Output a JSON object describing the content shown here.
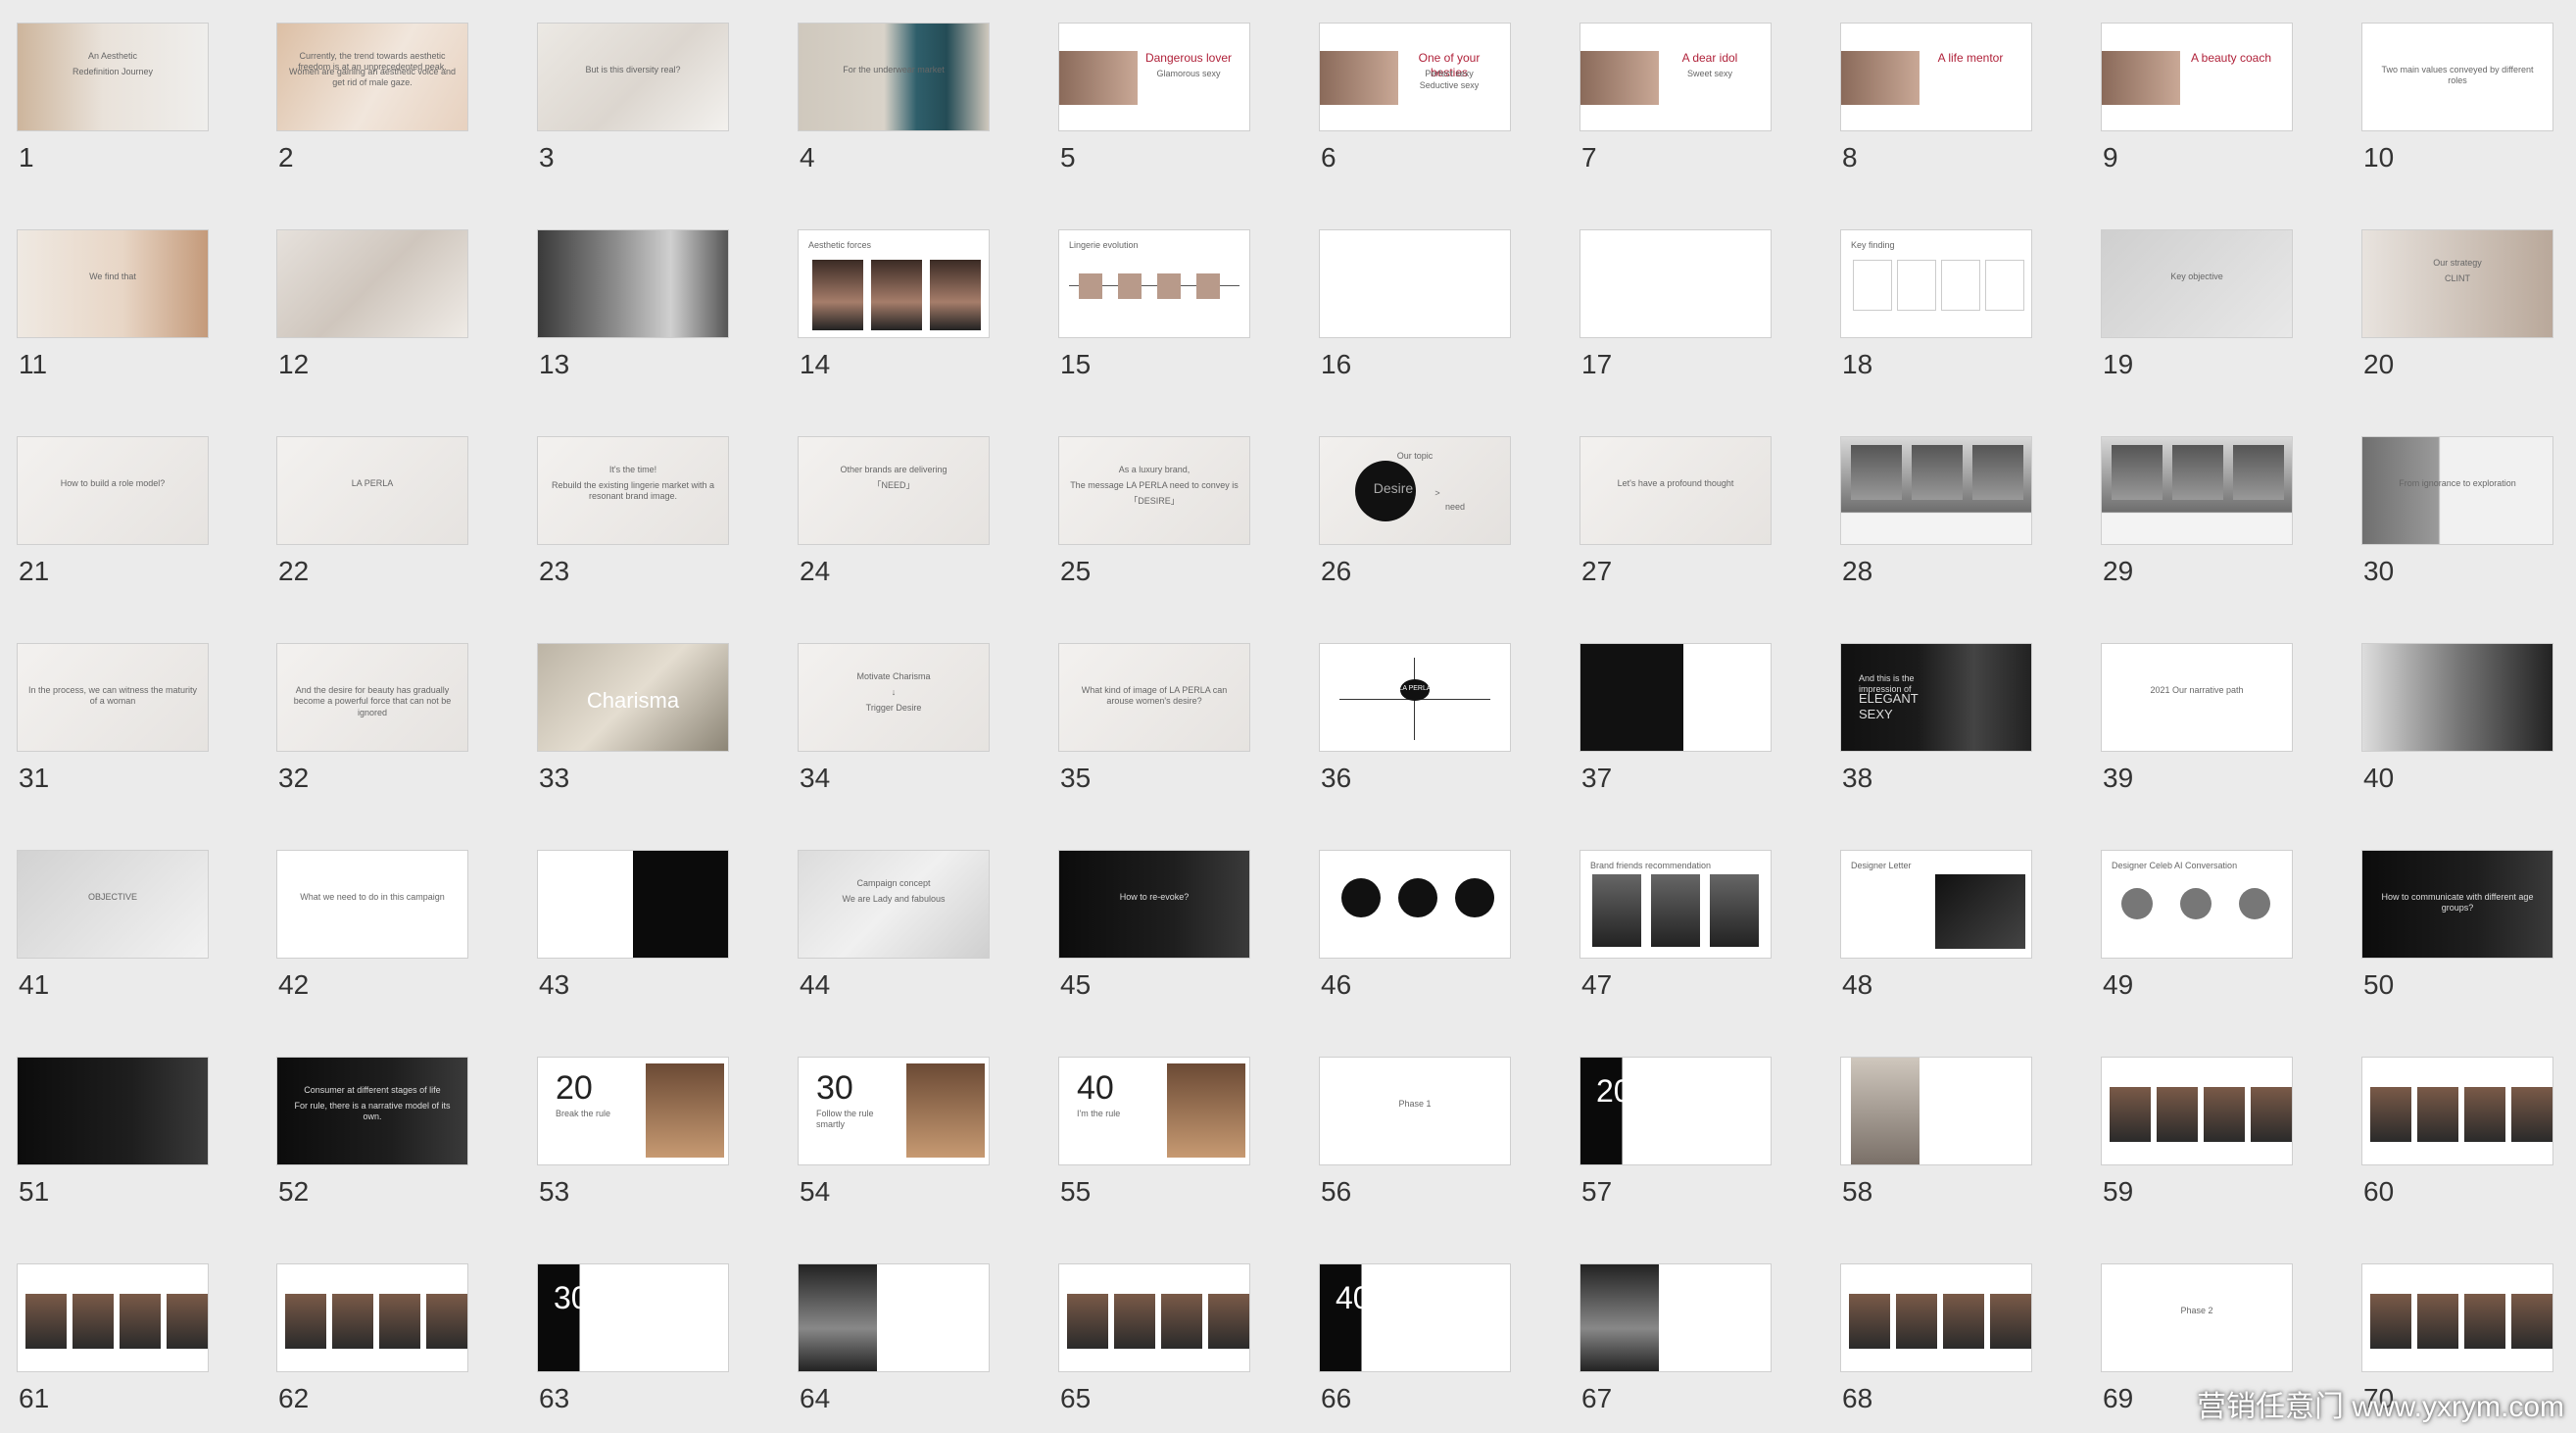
{
  "slides": [
    {
      "n": "1",
      "style": "photo-left",
      "texts": [
        "An Aesthetic",
        "Redefinition Journey"
      ]
    },
    {
      "n": "2",
      "style": "warm",
      "texts": [
        "Currently, the trend towards aesthetic freedom is at an unprecedented peak.",
        "Women are gaining an aesthetic voice and get rid of male gaze."
      ]
    },
    {
      "n": "3",
      "style": "light",
      "texts": [
        "But is this diversity real?"
      ]
    },
    {
      "n": "4",
      "style": "blue",
      "texts": [
        "For the underwear market"
      ]
    },
    {
      "n": "5",
      "style": "role",
      "texts": [
        "Dangerous lover",
        "Glamorous sexy"
      ]
    },
    {
      "n": "6",
      "style": "role",
      "texts": [
        "One of your besties",
        "Perfect sexy",
        "Seductive sexy"
      ]
    },
    {
      "n": "7",
      "style": "role",
      "texts": [
        "A dear idol",
        "Sweet sexy"
      ]
    },
    {
      "n": "8",
      "style": "role",
      "texts": [
        "A life mentor"
      ]
    },
    {
      "n": "9",
      "style": "role",
      "texts": [
        "A beauty coach"
      ]
    },
    {
      "n": "10",
      "style": "white",
      "texts": [
        "Two main values conveyed by different roles"
      ]
    },
    {
      "n": "11",
      "style": "photo-right",
      "texts": [
        "We find that"
      ]
    },
    {
      "n": "12",
      "style": "silk",
      "texts": []
    },
    {
      "n": "13",
      "style": "bw",
      "texts": []
    },
    {
      "n": "14",
      "style": "faces",
      "texts": [
        "Aesthetic forces"
      ]
    },
    {
      "n": "15",
      "style": "timeline",
      "texts": [
        "Lingerie evolution"
      ]
    },
    {
      "n": "16",
      "style": "white",
      "texts": []
    },
    {
      "n": "17",
      "style": "white",
      "texts": []
    },
    {
      "n": "18",
      "style": "cards",
      "texts": [
        "Key finding"
      ]
    },
    {
      "n": "19",
      "style": "grey",
      "texts": [
        "Key objective"
      ]
    },
    {
      "n": "20",
      "style": "strategy",
      "texts": [
        "Our strategy",
        "CLINT"
      ]
    },
    {
      "n": "21",
      "style": "pale",
      "texts": [
        "How to build a role model?"
      ]
    },
    {
      "n": "22",
      "style": "pale",
      "texts": [
        "LA PERLA"
      ]
    },
    {
      "n": "23",
      "style": "pale",
      "texts": [
        "It's the time!",
        "Rebuild the existing lingerie market with a resonant brand image."
      ]
    },
    {
      "n": "24",
      "style": "pale",
      "texts": [
        "Other brands are delivering",
        "「NEED」"
      ]
    },
    {
      "n": "25",
      "style": "pale",
      "texts": [
        "As a luxury brand,",
        "The message LA PERLA need to convey is",
        "「DESIRE」"
      ]
    },
    {
      "n": "26",
      "style": "desire",
      "texts": [
        "Our topic",
        "Desire",
        ">",
        "need"
      ]
    },
    {
      "n": "27",
      "style": "pale",
      "texts": [
        "Let's have a profound thought"
      ]
    },
    {
      "n": "28",
      "style": "trio",
      "texts": []
    },
    {
      "n": "29",
      "style": "trio",
      "texts": []
    },
    {
      "n": "30",
      "style": "greyphoto",
      "texts": [
        "From ignorance to exploration"
      ]
    },
    {
      "n": "31",
      "style": "pale",
      "texts": [
        "In the process, we can witness the maturity of a woman"
      ]
    },
    {
      "n": "32",
      "style": "pale",
      "texts": [
        "And the desire for beauty has gradually become a powerful force that can not be ignored"
      ]
    },
    {
      "n": "33",
      "style": "charisma",
      "texts": [
        "Charisma"
      ]
    },
    {
      "n": "34",
      "style": "pale",
      "texts": [
        "Motivate Charisma",
        "↓",
        "Trigger Desire"
      ]
    },
    {
      "n": "35",
      "style": "pale",
      "texts": [
        "What kind of image of LA PERLA can arouse women's desire?"
      ]
    },
    {
      "n": "36",
      "style": "axis",
      "texts": [
        "LA PERLA"
      ]
    },
    {
      "n": "37",
      "style": "darkleft",
      "texts": []
    },
    {
      "n": "38",
      "style": "elegant",
      "texts": [
        "And this is the impression of",
        "ELEGANT",
        "SEXY"
      ]
    },
    {
      "n": "39",
      "style": "white",
      "texts": [
        "2021 Our narrative path"
      ]
    },
    {
      "n": "40",
      "style": "bwface",
      "texts": []
    },
    {
      "n": "41",
      "style": "objective",
      "texts": [
        "OBJECTIVE"
      ]
    },
    {
      "n": "42",
      "style": "white",
      "texts": [
        "What we need to do in this campaign"
      ]
    },
    {
      "n": "43",
      "style": "split",
      "texts": []
    },
    {
      "n": "44",
      "style": "lace",
      "texts": [
        "Campaign concept",
        "We are Lady and fabulous"
      ]
    },
    {
      "n": "45",
      "style": "dark",
      "texts": [
        "How to re-evoke?"
      ]
    },
    {
      "n": "46",
      "style": "circles",
      "texts": []
    },
    {
      "n": "47",
      "style": "celebs",
      "texts": [
        "Brand friends recommendation"
      ]
    },
    {
      "n": "48",
      "style": "designer",
      "texts": [
        "Designer Letter"
      ]
    },
    {
      "n": "49",
      "style": "convo",
      "texts": [
        "Designer Celeb AI Conversation"
      ]
    },
    {
      "n": "50",
      "style": "dark",
      "texts": [
        "How to communicate with different age groups?"
      ]
    },
    {
      "n": "51",
      "style": "dark",
      "texts": []
    },
    {
      "n": "52",
      "style": "dark",
      "texts": [
        "Consumer at different stages of life",
        "For rule, there is a narrative model of its own."
      ]
    },
    {
      "n": "53",
      "style": "age",
      "texts": [
        "20",
        "Break the rule"
      ]
    },
    {
      "n": "54",
      "style": "age",
      "texts": [
        "30",
        "Follow the rule smartly"
      ]
    },
    {
      "n": "55",
      "style": "age",
      "texts": [
        "40",
        "I'm the rule"
      ]
    },
    {
      "n": "56",
      "style": "white",
      "texts": [
        "Phase 1"
      ]
    },
    {
      "n": "57",
      "style": "agedark",
      "texts": [
        "20"
      ]
    },
    {
      "n": "58",
      "style": "fashion",
      "texts": []
    },
    {
      "n": "59",
      "style": "gallery",
      "texts": []
    },
    {
      "n": "60",
      "style": "gallery",
      "texts": []
    },
    {
      "n": "61",
      "style": "gallery",
      "texts": []
    },
    {
      "n": "62",
      "style": "gallery",
      "texts": []
    },
    {
      "n": "63",
      "style": "agedark",
      "texts": [
        "30"
      ]
    },
    {
      "n": "64",
      "style": "portrait",
      "texts": []
    },
    {
      "n": "65",
      "style": "gallery",
      "texts": []
    },
    {
      "n": "66",
      "style": "agedark",
      "texts": [
        "40"
      ]
    },
    {
      "n": "67",
      "style": "portrait",
      "texts": []
    },
    {
      "n": "68",
      "style": "gallery",
      "texts": []
    },
    {
      "n": "69",
      "style": "white",
      "texts": [
        "Phase 2"
      ]
    },
    {
      "n": "70",
      "style": "gallery",
      "texts": []
    }
  ],
  "watermark": "营销任意门 www.yxrym.com",
  "colors": {
    "background": "#ebebeb",
    "accent_red": "#b0223a"
  }
}
